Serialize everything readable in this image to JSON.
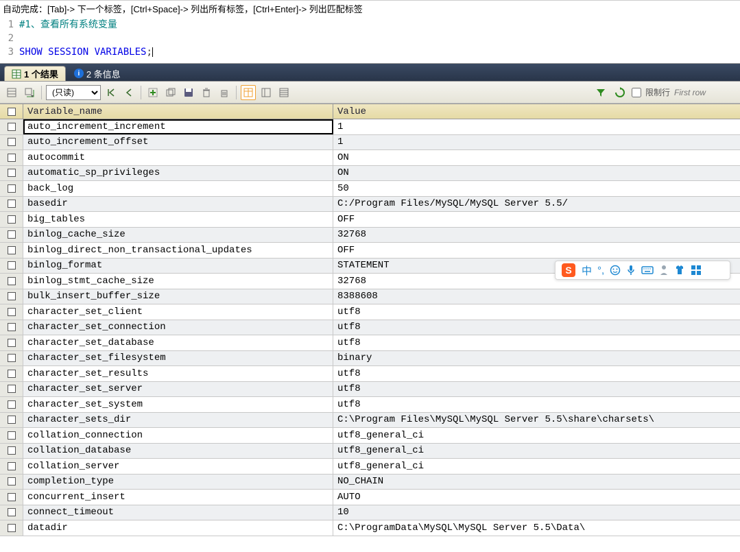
{
  "hint_bar": "自动完成：[Tab]-> 下一个标签，[Ctrl+Space]-> 列出所有标签，[Ctrl+Enter]-> 列出匹配标签",
  "code": {
    "line_numbers": [
      "1",
      "2",
      "3"
    ],
    "line1_comment": "#1、查看所有系统变量",
    "line3_sql": "SHOW SESSION VARIABLES",
    "line3_semicolon": ";"
  },
  "tabs": {
    "result": "1 个结果",
    "messages": "2 条信息"
  },
  "toolbar": {
    "mode_select": "(只读)",
    "limit_label": "限制行",
    "first_row_placeholder": "First row"
  },
  "grid": {
    "headers": {
      "name": "Variable_name",
      "value": "Value"
    },
    "rows": [
      {
        "name": "auto_increment_increment",
        "value": "1",
        "selected": true
      },
      {
        "name": "auto_increment_offset",
        "value": "1"
      },
      {
        "name": "autocommit",
        "value": "ON"
      },
      {
        "name": "automatic_sp_privileges",
        "value": "ON"
      },
      {
        "name": "back_log",
        "value": "50"
      },
      {
        "name": "basedir",
        "value": "C:/Program Files/MySQL/MySQL Server 5.5/"
      },
      {
        "name": "big_tables",
        "value": "OFF"
      },
      {
        "name": "binlog_cache_size",
        "value": "32768"
      },
      {
        "name": "binlog_direct_non_transactional_updates",
        "value": "OFF"
      },
      {
        "name": "binlog_format",
        "value": "STATEMENT"
      },
      {
        "name": "binlog_stmt_cache_size",
        "value": "32768"
      },
      {
        "name": "bulk_insert_buffer_size",
        "value": "8388608"
      },
      {
        "name": "character_set_client",
        "value": "utf8"
      },
      {
        "name": "character_set_connection",
        "value": "utf8"
      },
      {
        "name": "character_set_database",
        "value": "utf8"
      },
      {
        "name": "character_set_filesystem",
        "value": "binary"
      },
      {
        "name": "character_set_results",
        "value": "utf8"
      },
      {
        "name": "character_set_server",
        "value": "utf8"
      },
      {
        "name": "character_set_system",
        "value": "utf8"
      },
      {
        "name": "character_sets_dir",
        "value": "C:\\Program Files\\MySQL\\MySQL Server 5.5\\share\\charsets\\"
      },
      {
        "name": "collation_connection",
        "value": "utf8_general_ci"
      },
      {
        "name": "collation_database",
        "value": "utf8_general_ci"
      },
      {
        "name": "collation_server",
        "value": "utf8_general_ci"
      },
      {
        "name": "completion_type",
        "value": "NO_CHAIN"
      },
      {
        "name": "concurrent_insert",
        "value": "AUTO"
      },
      {
        "name": "connect_timeout",
        "value": "10"
      },
      {
        "name": "datadir",
        "value": "C:\\ProgramData\\MySQL\\MySQL Server 5.5\\Data\\"
      }
    ]
  },
  "ime": {
    "logo": "S",
    "zhong": "中"
  }
}
